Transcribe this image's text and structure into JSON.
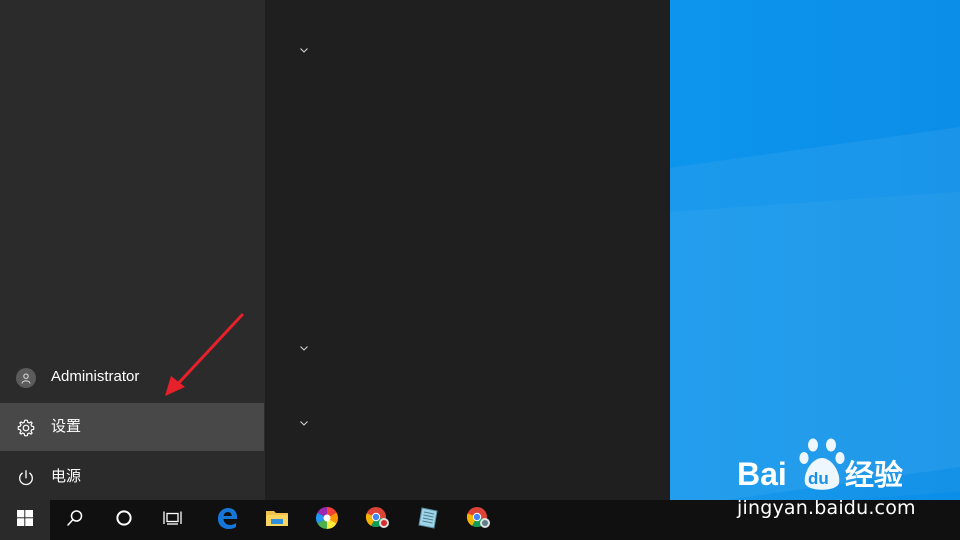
{
  "start_menu": {
    "user": {
      "label": "Administrator",
      "icon": "user-avatar-icon"
    },
    "settings": {
      "label": "设置",
      "icon": "gear-icon"
    },
    "power": {
      "label": "电源",
      "icon": "power-icon"
    }
  },
  "tile_groups": [
    {
      "icon": "chevron-down-icon"
    },
    {
      "icon": "chevron-down-icon"
    },
    {
      "icon": "chevron-down-icon"
    }
  ],
  "taskbar": {
    "items": [
      {
        "name": "start",
        "icon": "windows-logo-icon"
      },
      {
        "name": "search",
        "icon": "search-icon"
      },
      {
        "name": "cortana",
        "icon": "cortana-circle-icon"
      },
      {
        "name": "task-view",
        "icon": "task-view-icon"
      },
      {
        "name": "edge",
        "icon": "edge-icon"
      },
      {
        "name": "file-explorer",
        "icon": "folder-icon"
      },
      {
        "name": "pinwheel-app",
        "icon": "pinwheel-icon"
      },
      {
        "name": "chrome-app-1",
        "icon": "chrome-icon"
      },
      {
        "name": "notepad-app",
        "icon": "notebook-icon"
      },
      {
        "name": "chrome-app-2",
        "icon": "chrome-icon"
      }
    ]
  },
  "watermark": {
    "brand_latin": "Bai",
    "brand_paw": "du",
    "brand_cn": "经验",
    "url": "jingyan.baidu.com"
  },
  "colors": {
    "desktop_blue": "#0b8ee8",
    "start_panel": "#2b2b2b",
    "tiles_panel": "#1f1f1f",
    "highlight": "#484848",
    "taskbar": "#101010",
    "annotation_arrow": "#e8202a"
  }
}
